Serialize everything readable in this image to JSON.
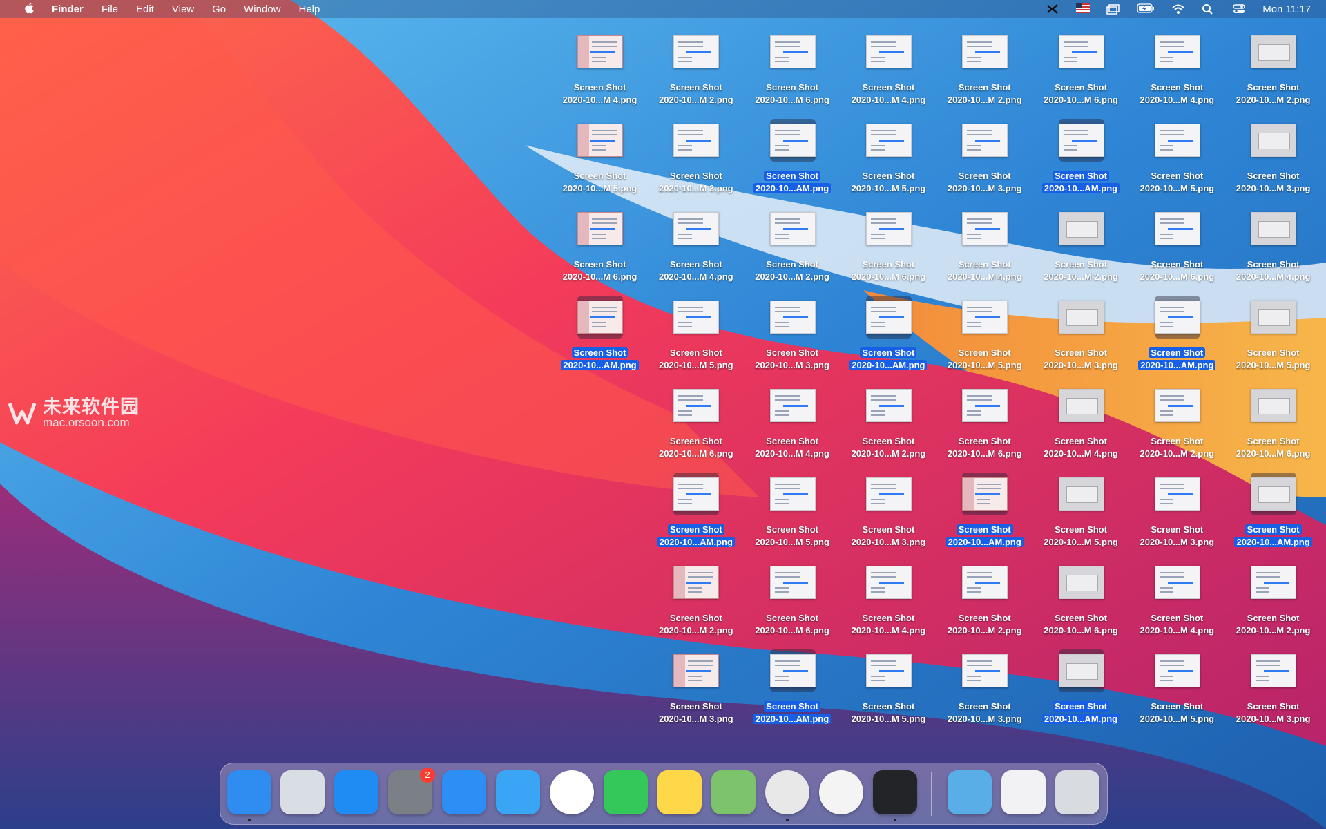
{
  "menubar": {
    "apple_icon": "apple-icon",
    "app_name": "Finder",
    "menus": [
      "File",
      "Edit",
      "View",
      "Go",
      "Window",
      "Help"
    ],
    "status_icons": [
      "tool-icon",
      "us-flag-icon",
      "screens-icon",
      "battery-charging-icon",
      "wifi-icon",
      "search-icon",
      "control-center-icon"
    ],
    "clock": "Mon 11:17"
  },
  "watermark": {
    "text_cn": "未来软件园",
    "text_url": "mac.orsoon.com"
  },
  "desktop": {
    "file_title": "Screen Shot",
    "files": [
      {
        "name": "2020-10...M 4.png",
        "selected": false,
        "style": "red"
      },
      {
        "name": "2020-10...M 2.png",
        "selected": false,
        "style": "white"
      },
      {
        "name": "2020-10...M 6.png",
        "selected": false,
        "style": "white"
      },
      {
        "name": "2020-10...M 4.png",
        "selected": false,
        "style": "white"
      },
      {
        "name": "2020-10...M 2.png",
        "selected": false,
        "style": "white"
      },
      {
        "name": "2020-10...M 6.png",
        "selected": false,
        "style": "white"
      },
      {
        "name": "2020-10...M 4.png",
        "selected": false,
        "style": "white"
      },
      {
        "name": "2020-10...M 2.png",
        "selected": false,
        "style": "gray"
      },
      {
        "name": "2020-10...M 5.png",
        "selected": false,
        "style": "red"
      },
      {
        "name": "2020-10...M 3.png",
        "selected": false,
        "style": "white"
      },
      {
        "name": "2020-10...AM.png",
        "selected": true,
        "style": "white"
      },
      {
        "name": "2020-10...M 5.png",
        "selected": false,
        "style": "white"
      },
      {
        "name": "2020-10...M 3.png",
        "selected": false,
        "style": "white"
      },
      {
        "name": "2020-10...AM.png",
        "selected": true,
        "style": "white"
      },
      {
        "name": "2020-10...M 5.png",
        "selected": false,
        "style": "white"
      },
      {
        "name": "2020-10...M 3.png",
        "selected": false,
        "style": "gray"
      },
      {
        "name": "2020-10...M 6.png",
        "selected": false,
        "style": "red"
      },
      {
        "name": "2020-10...M 4.png",
        "selected": false,
        "style": "white"
      },
      {
        "name": "2020-10...M 2.png",
        "selected": false,
        "style": "white"
      },
      {
        "name": "2020-10...M 6.png",
        "selected": false,
        "style": "white"
      },
      {
        "name": "2020-10...M 4.png",
        "selected": false,
        "style": "white"
      },
      {
        "name": "2020-10...M 2.png",
        "selected": false,
        "style": "gray"
      },
      {
        "name": "2020-10...M 6.png",
        "selected": false,
        "style": "white"
      },
      {
        "name": "2020-10...M 4.png",
        "selected": false,
        "style": "gray"
      },
      {
        "name": "2020-10...AM.png",
        "selected": true,
        "style": "red"
      },
      {
        "name": "2020-10...M 5.png",
        "selected": false,
        "style": "white"
      },
      {
        "name": "2020-10...M 3.png",
        "selected": false,
        "style": "white"
      },
      {
        "name": "2020-10...AM.png",
        "selected": true,
        "style": "white"
      },
      {
        "name": "2020-10...M 5.png",
        "selected": false,
        "style": "white"
      },
      {
        "name": "2020-10...M 3.png",
        "selected": false,
        "style": "gray"
      },
      {
        "name": "2020-10...AM.png",
        "selected": true,
        "style": "white"
      },
      {
        "name": "2020-10...M 5.png",
        "selected": false,
        "style": "gray"
      },
      {
        "name": "",
        "selected": false,
        "style": "none"
      },
      {
        "name": "2020-10...M 6.png",
        "selected": false,
        "style": "white"
      },
      {
        "name": "2020-10...M 4.png",
        "selected": false,
        "style": "white"
      },
      {
        "name": "2020-10...M 2.png",
        "selected": false,
        "style": "white"
      },
      {
        "name": "2020-10...M 6.png",
        "selected": false,
        "style": "white"
      },
      {
        "name": "2020-10...M 4.png",
        "selected": false,
        "style": "gray"
      },
      {
        "name": "2020-10...M 2.png",
        "selected": false,
        "style": "white"
      },
      {
        "name": "2020-10...M 6.png",
        "selected": false,
        "style": "gray"
      },
      {
        "name": "",
        "selected": false,
        "style": "none"
      },
      {
        "name": "2020-10...AM.png",
        "selected": true,
        "style": "white"
      },
      {
        "name": "2020-10...M 5.png",
        "selected": false,
        "style": "white"
      },
      {
        "name": "2020-10...M 3.png",
        "selected": false,
        "style": "white"
      },
      {
        "name": "2020-10...AM.png",
        "selected": true,
        "style": "red"
      },
      {
        "name": "2020-10...M 5.png",
        "selected": false,
        "style": "gray"
      },
      {
        "name": "2020-10...M 3.png",
        "selected": false,
        "style": "white"
      },
      {
        "name": "2020-10...AM.png",
        "selected": true,
        "style": "gray"
      },
      {
        "name": "",
        "selected": false,
        "style": "none"
      },
      {
        "name": "2020-10...M 2.png",
        "selected": false,
        "style": "red"
      },
      {
        "name": "2020-10...M 6.png",
        "selected": false,
        "style": "white"
      },
      {
        "name": "2020-10...M 4.png",
        "selected": false,
        "style": "white"
      },
      {
        "name": "2020-10...M 2.png",
        "selected": false,
        "style": "white"
      },
      {
        "name": "2020-10...M 6.png",
        "selected": false,
        "style": "gray"
      },
      {
        "name": "2020-10...M 4.png",
        "selected": false,
        "style": "white"
      },
      {
        "name": "2020-10...M 2.png",
        "selected": false,
        "style": "white"
      },
      {
        "name": "",
        "selected": false,
        "style": "none"
      },
      {
        "name": "2020-10...M 3.png",
        "selected": false,
        "style": "red"
      },
      {
        "name": "2020-10...AM.png",
        "selected": true,
        "style": "white"
      },
      {
        "name": "2020-10...M 5.png",
        "selected": false,
        "style": "white"
      },
      {
        "name": "2020-10...M 3.png",
        "selected": false,
        "style": "white"
      },
      {
        "name": "2020-10...AM.png",
        "selected": true,
        "style": "gray"
      },
      {
        "name": "2020-10...M 5.png",
        "selected": false,
        "style": "white"
      },
      {
        "name": "2020-10...M 3.png",
        "selected": false,
        "style": "white"
      }
    ]
  },
  "dock": {
    "items": [
      {
        "name": "finder-icon",
        "color": "#2f8cf0",
        "running": true
      },
      {
        "name": "launchpad-icon",
        "color": "#d9dde4",
        "running": false
      },
      {
        "name": "app-store-icon",
        "color": "#1e8cf2",
        "running": false
      },
      {
        "name": "system-preferences-icon",
        "color": "#7b7f86",
        "running": false,
        "badge": "2"
      },
      {
        "name": "mail-icon",
        "color": "#2d8ff5",
        "running": false
      },
      {
        "name": "safari-icon",
        "color": "#3aa5f5",
        "running": false
      },
      {
        "name": "slack-icon",
        "color": "#ffffff",
        "running": false
      },
      {
        "name": "messages-icon",
        "color": "#34c759",
        "running": false
      },
      {
        "name": "notes-icon",
        "color": "#ffd84a",
        "running": false
      },
      {
        "name": "maps-icon",
        "color": "#7cc36b",
        "running": false
      },
      {
        "name": "chrome-icon",
        "color": "#e8e8e8",
        "running": true
      },
      {
        "name": "pinwheel-app-icon",
        "color": "#f4f4f4",
        "running": false
      },
      {
        "name": "activity-monitor-icon",
        "color": "#222428",
        "running": true
      },
      {
        "name": "downloads-folder-icon",
        "color": "#5aaee8",
        "running": false
      },
      {
        "name": "recent-window-icon",
        "color": "#f2f2f4",
        "running": false
      },
      {
        "name": "trash-icon",
        "color": "#d8dce0",
        "running": false
      }
    ]
  }
}
